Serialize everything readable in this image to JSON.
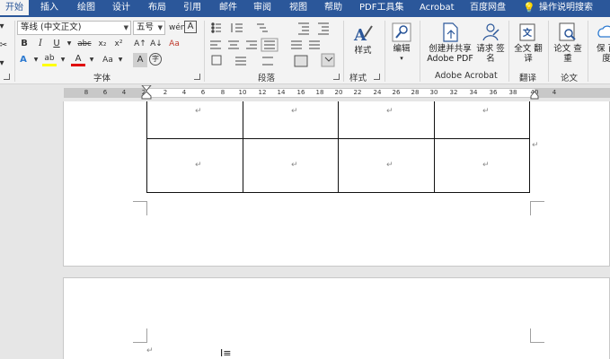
{
  "tabs": [
    "开始",
    "插入",
    "绘图",
    "设计",
    "布局",
    "引用",
    "邮件",
    "审阅",
    "视图",
    "帮助",
    "PDF工具集",
    "Acrobat",
    "百度网盘",
    "操作说明搜索"
  ],
  "font": {
    "name": "等线 (中文正文)",
    "size": "五号",
    "grow_icon": "A↑",
    "shrink_icon": "A↓",
    "clear_icon": "Aa",
    "pinyin_icon": "wén",
    "border_icon": "A",
    "bold": "B",
    "italic": "I",
    "underline": "U",
    "strike": "abc",
    "subscript": "x₂",
    "superscript": "x²",
    "effects_icon": "A",
    "highlight_icon": "ab",
    "font_color_icon": "A",
    "case_icon": "Aa",
    "shade_icon": "A",
    "circle_icon": "字",
    "label": "字体"
  },
  "paragraph": {
    "label": "段落"
  },
  "styles": {
    "label": "样式",
    "button": "样式"
  },
  "editing": {
    "button": "编辑"
  },
  "acrobat": {
    "create_share": "创建并共享 Adobe PDF",
    "request_sign": "请求 签名",
    "label": "Adobe Acrobat"
  },
  "translate": {
    "button": "全文 翻译",
    "label": "翻译"
  },
  "paper": {
    "button": "论文 查重",
    "label": "论文"
  },
  "save": {
    "button": "保 百度"
  },
  "ruler_numbers": [
    "8",
    "6",
    "4",
    "2",
    "2",
    "4",
    "6",
    "8",
    "10",
    "12",
    "14",
    "16",
    "18",
    "20",
    "22",
    "24",
    "26",
    "28",
    "30",
    "32",
    "34",
    "36",
    "38",
    "40",
    "4"
  ],
  "cell_mark": "↵",
  "colors": {
    "accent": "#2b579a",
    "highlight": "#ffff00",
    "font_color": "#e00000"
  }
}
